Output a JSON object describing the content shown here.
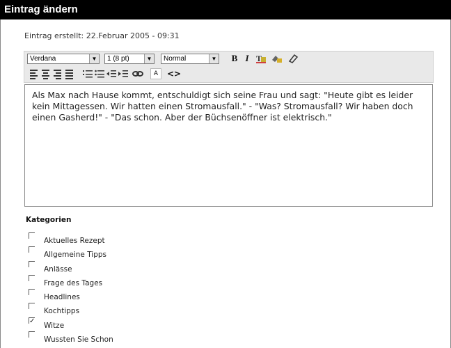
{
  "window": {
    "title": "Eintrag ändern"
  },
  "meta": {
    "created": "Eintrag erstellt: 22.Februar 2005 - 09:31"
  },
  "toolbar": {
    "font_select": "Verdana",
    "size_select": "1 (8 pt)",
    "style_select": "Normal",
    "bold": "B",
    "italic": "I",
    "text_color_icon": "text-color-icon",
    "highlight_icon": "highlight-icon",
    "eraser_icon": "eraser-icon",
    "link_icon": "link-icon",
    "font_button": "A",
    "source_icon": "<>"
  },
  "editor": {
    "text": "Als Max nach Hause kommt, entschuldigt sich seine Frau und sagt: \"Heute gibt es leider kein Mittagessen. Wir hatten einen Stromausfall.\" - \"Was? Stromausfall? Wir haben doch einen Gasherd!\" - \"Das schon. Aber der Büchsenöffner ist elektrisch.\""
  },
  "categories": {
    "title": "Kategorien",
    "items": [
      {
        "label": "Aktuelles Rezept",
        "checked": false
      },
      {
        "label": "Allgemeine Tipps",
        "checked": false
      },
      {
        "label": "Anlässe",
        "checked": false
      },
      {
        "label": "Frage des Tages",
        "checked": false
      },
      {
        "label": "Headlines",
        "checked": false
      },
      {
        "label": "Kochtipps",
        "checked": false
      },
      {
        "label": "Witze",
        "checked": true
      },
      {
        "label": "Wussten Sie Schon",
        "checked": false
      }
    ]
  }
}
